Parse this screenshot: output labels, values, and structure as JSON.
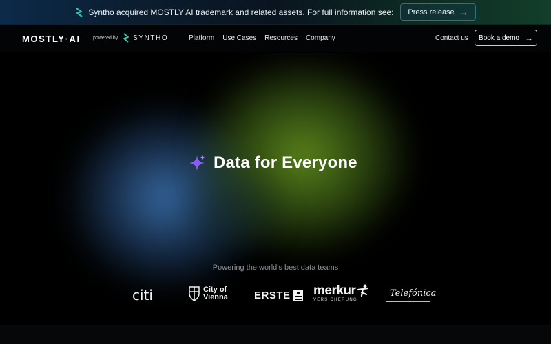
{
  "banner": {
    "text": "Syntho acquired MOSTLY AI trademark and related assets. For full information see:",
    "button_label": "Press release",
    "icon": "arrow-right-icon"
  },
  "nav": {
    "logo_left": "MOSTLY",
    "logo_dot": "·",
    "logo_right": "AI",
    "powered_by": "powered by",
    "partner": "SYNTHO",
    "menu": [
      "Platform",
      "Use Cases",
      "Resources",
      "Company"
    ],
    "contact": "Contact us",
    "demo_button": "Book a demo"
  },
  "hero": {
    "headline": "Data for Everyone",
    "icon": "sparkle-icon",
    "tagline": "Powering the world's best data teams"
  },
  "customers": {
    "citi": "citi",
    "vienna_line1": "City of",
    "vienna_line2": "Vienna",
    "erste": "ERSTE",
    "merkur": "merkur",
    "merkur_sub": "VERSICHERUNG",
    "telefonica": "Telefónica"
  },
  "colors": {
    "accent_teal": "#2e6f8a",
    "sparkle_purple": "#8a5cf6",
    "glow_blue": "#3a6eaa",
    "glow_green": "#608c1c"
  }
}
